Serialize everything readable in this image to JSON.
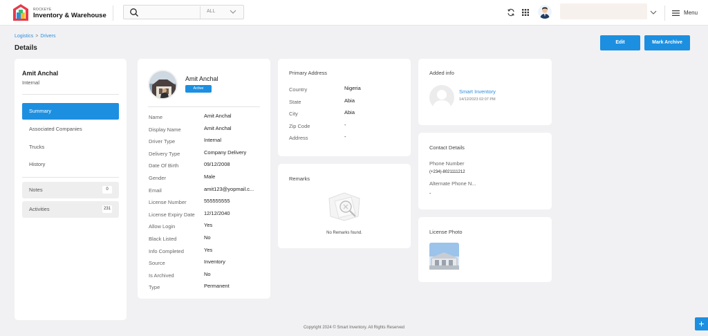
{
  "header": {
    "brand_small": "ROCKEYE",
    "brand": "Inventory & Warehouse",
    "search_placeholder": "",
    "search_scope": "ALL",
    "menu_label": "Menu"
  },
  "breadcrumb": [
    "Logistics",
    ">",
    "Drivers"
  ],
  "page_title": "Details",
  "actions": {
    "edit": "Edit",
    "archive": "Mark Archive"
  },
  "sidebar": {
    "name": "Amit Anchal",
    "subtitle": "Internal",
    "items": [
      "Summary",
      "Associated Companies",
      "Trucks",
      "History"
    ],
    "pills": [
      {
        "label": "Notes",
        "count": "0"
      },
      {
        "label": "Activities",
        "count": "231"
      }
    ]
  },
  "driver": {
    "name": "Amit Anchal",
    "status": "Active",
    "rows": [
      {
        "label": "Name",
        "value": "Amit Anchal"
      },
      {
        "label": "Display Name",
        "value": "Amit Anchal"
      },
      {
        "label": "Driver Type",
        "value": "Internal"
      },
      {
        "label": "Delivery Type",
        "value": "Company Delivery"
      },
      {
        "label": "Date Of Birth",
        "value": "09/12/2008"
      },
      {
        "label": "Gender",
        "value": "Male"
      },
      {
        "label": "Email",
        "value": "amit123@yopmail.c..."
      },
      {
        "label": "License Number",
        "value": "555555555"
      },
      {
        "label": "License Expiry Date",
        "value": "12/12/2040"
      },
      {
        "label": "Allow Login",
        "value": "Yes"
      },
      {
        "label": "Black Listed",
        "value": "No"
      },
      {
        "label": "Info Completed",
        "value": "Yes"
      },
      {
        "label": "Source",
        "value": "Inventory"
      },
      {
        "label": "Is Archived",
        "value": "No"
      },
      {
        "label": "Type",
        "value": "Permanent"
      }
    ]
  },
  "address": {
    "title": "Primary Address",
    "rows": [
      {
        "label": "Country",
        "value": "Nigeria"
      },
      {
        "label": "State",
        "value": "Abia"
      },
      {
        "label": "City",
        "value": "Abia"
      },
      {
        "label": "Zip Code",
        "value": "-"
      },
      {
        "label": "Address",
        "value": "-"
      }
    ]
  },
  "remarks": {
    "title": "Remarks",
    "empty": "No Remarks found."
  },
  "added_info": {
    "title": "Added info",
    "user": "Smart Inventory",
    "date": "14/12/2023 02:07 PM"
  },
  "contact": {
    "title": "Contact Details",
    "phone_label": "Phone Number",
    "phone_value": "(+234)-8021111212",
    "alt_label": "Alternate Phone N...",
    "alt_value": "-"
  },
  "license_photo": {
    "title": "License Photo"
  },
  "footer": "Copyright 2024 © Smart Inventory. All Rights Reserved",
  "colors": {
    "accent": "#1d8fe0",
    "background": "#f1f1f3"
  }
}
